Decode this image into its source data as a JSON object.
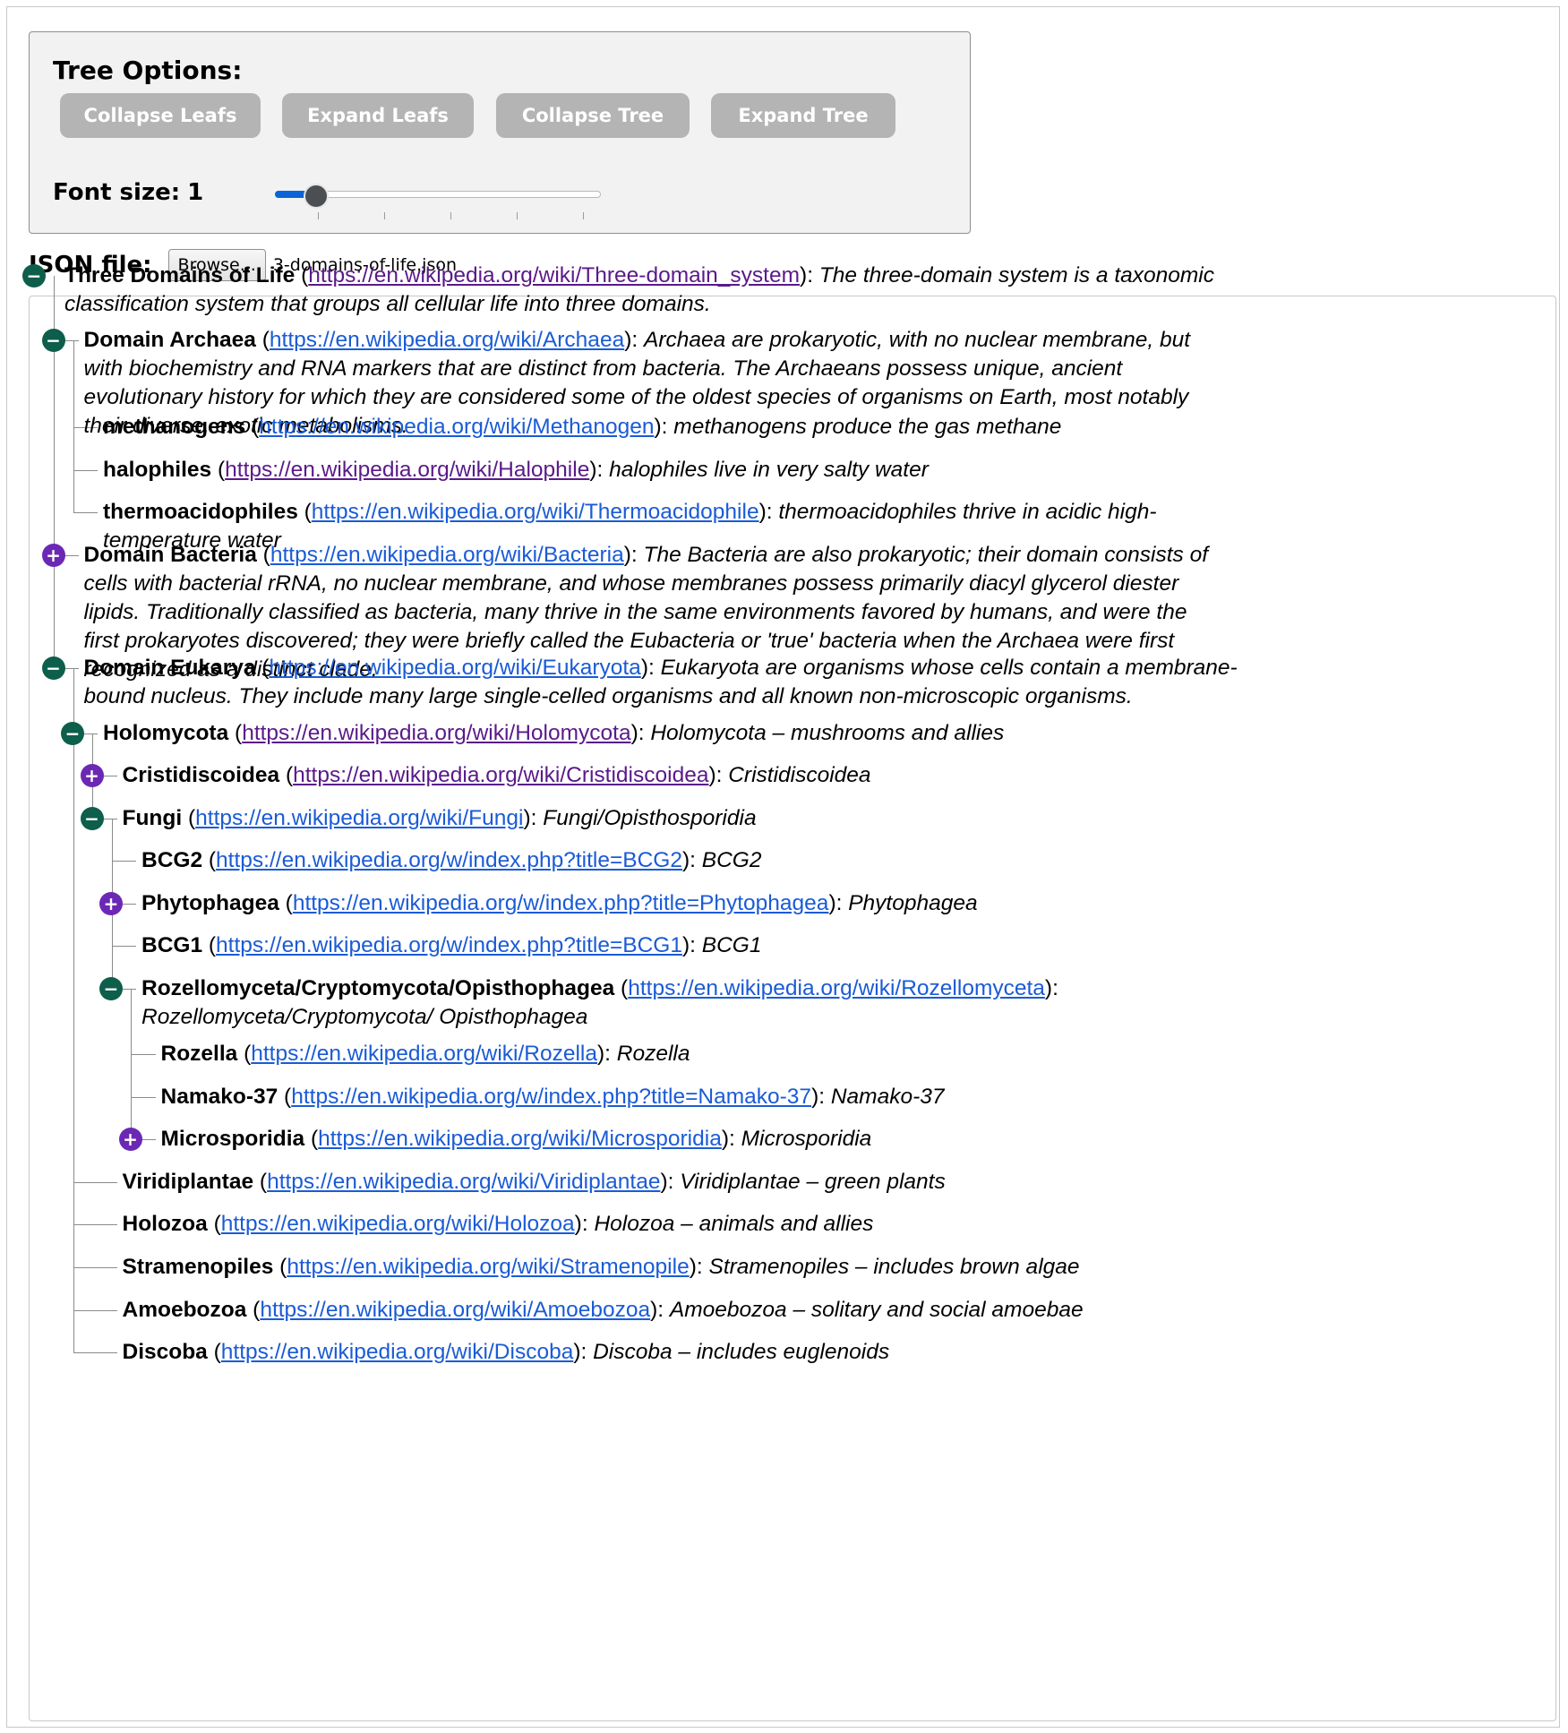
{
  "options": {
    "title": "Tree Options:",
    "buttons": [
      "Collapse Leafs",
      "Expand Leafs",
      "Collapse Tree",
      "Expand Tree"
    ],
    "font_size_label": "Font size:",
    "font_size_value": "1",
    "slider_level": 1,
    "slider_max": 6
  },
  "file": {
    "label": "JSON file:",
    "browse_label": "Browse...",
    "filename": "3-domains-of-life.json"
  },
  "colors": {
    "expanded_toggle": "#0e5e4c",
    "collapsed_toggle": "#6b28b5",
    "link": "#1a5bd6",
    "visited_link": "#5a1a8a"
  },
  "icons": {
    "expanded": "minus-circle-icon",
    "collapsed": "plus-circle-icon"
  },
  "tree": [
    {
      "name": "Three Domains of Life",
      "url": "https://en.wikipedia.org/wiki/Three-domain_system",
      "desc": "The three-domain system is a taxonomic classification system that groups all cellular life into three domains.",
      "state": "expanded",
      "visited": true
    },
    {
      "name": "Domain Archaea",
      "url": "https://en.wikipedia.org/wiki/Archaea",
      "desc": "Archaea are prokaryotic, with no nuclear membrane, but with biochemistry and RNA markers that are distinct from bacteria. The Archaeans possess unique, ancient evolutionary history for which they are considered some of the oldest species of organisms on Earth, most notably their diverse, exotic metabolisms.",
      "state": "expanded",
      "visited": false
    },
    {
      "name": "methanogens",
      "url": "https://en.wikipedia.org/wiki/Methanogen",
      "desc": "methanogens produce the gas methane",
      "state": "leaf",
      "visited": false
    },
    {
      "name": "halophiles",
      "url": "https://en.wikipedia.org/wiki/Halophile",
      "desc": "halophiles live in very salty water",
      "state": "leaf",
      "visited": true
    },
    {
      "name": "thermoacidophiles",
      "url": "https://en.wikipedia.org/wiki/Thermoacidophile",
      "desc": "thermoacidophiles thrive in acidic high-temperature water",
      "state": "leaf",
      "visited": false
    },
    {
      "name": "Domain Bacteria",
      "url": "https://en.wikipedia.org/wiki/Bacteria",
      "desc": "The Bacteria are also prokaryotic; their domain consists of cells with bacterial rRNA, no nuclear membrane, and whose membranes possess primarily diacyl glycerol diester lipids. Traditionally classified as bacteria, many thrive in the same environments favored by humans, and were the first prokaryotes discovered; they were briefly called the Eubacteria or 'true' bacteria when the Archaea were first recognized as a distinct clade.",
      "state": "collapsed",
      "visited": false
    },
    {
      "name": "Domain Eukarya",
      "url": "https://en.wikipedia.org/wiki/Eukaryota",
      "desc": "Eukaryota are organisms whose cells contain a membrane-bound nucleus. They include many large single-celled organisms and all known non-microscopic organisms.",
      "state": "expanded",
      "visited": false
    },
    {
      "name": "Holomycota",
      "url": "https://en.wikipedia.org/wiki/Holomycota",
      "desc": "Holomycota – mushrooms and allies",
      "state": "expanded",
      "visited": true
    },
    {
      "name": "Cristidiscoidea",
      "url": "https://en.wikipedia.org/wiki/Cristidiscoidea",
      "desc": "Cristidiscoidea",
      "state": "collapsed",
      "visited": true
    },
    {
      "name": "Fungi",
      "url": "https://en.wikipedia.org/wiki/Fungi",
      "desc": "Fungi/Opisthosporidia",
      "state": "expanded",
      "visited": false
    },
    {
      "name": "BCG2",
      "url": "https://en.wikipedia.org/w/index.php?title=BCG2",
      "desc": "BCG2",
      "state": "leaf",
      "visited": false
    },
    {
      "name": "Phytophagea",
      "url": "https://en.wikipedia.org/w/index.php?title=Phytophagea",
      "desc": "Phytophagea",
      "state": "collapsed",
      "visited": false
    },
    {
      "name": "BCG1",
      "url": "https://en.wikipedia.org/w/index.php?title=BCG1",
      "desc": "BCG1",
      "state": "leaf",
      "visited": false
    },
    {
      "name": "Rozellomyceta/Cryptomycota/Opisthophagea",
      "url": "https://en.wikipedia.org/wiki/Rozellomyceta",
      "desc": "Rozellomyceta/Cryptomycota/ Opisthophagea",
      "state": "expanded",
      "visited": false
    },
    {
      "name": "Rozella",
      "url": "https://en.wikipedia.org/wiki/Rozella",
      "desc": "Rozella",
      "state": "leaf",
      "visited": false
    },
    {
      "name": "Namako-37",
      "url": "https://en.wikipedia.org/w/index.php?title=Namako-37",
      "desc": "Namako-37",
      "state": "leaf",
      "visited": false
    },
    {
      "name": "Microsporidia",
      "url": "https://en.wikipedia.org/wiki/Microsporidia",
      "desc": "Microsporidia",
      "state": "collapsed",
      "visited": false
    },
    {
      "name": "Viridiplantae",
      "url": "https://en.wikipedia.org/wiki/Viridiplantae",
      "desc": "Viridiplantae – green plants",
      "state": "leaf",
      "visited": false
    },
    {
      "name": "Holozoa",
      "url": "https://en.wikipedia.org/wiki/Holozoa",
      "desc": "Holozoa – animals and allies",
      "state": "leaf",
      "visited": false
    },
    {
      "name": "Stramenopiles",
      "url": "https://en.wikipedia.org/wiki/Stramenopile",
      "desc": "Stramenopiles – includes brown algae",
      "state": "leaf",
      "visited": false
    },
    {
      "name": "Amoebozoa",
      "url": "https://en.wikipedia.org/wiki/Amoebozoa",
      "desc": "Amoebozoa – solitary and social amoebae",
      "state": "leaf",
      "visited": false
    },
    {
      "name": "Discoba",
      "url": "https://en.wikipedia.org/wiki/Discoba",
      "desc": "Discoba – includes euglenoids",
      "state": "leaf",
      "visited": false
    }
  ]
}
